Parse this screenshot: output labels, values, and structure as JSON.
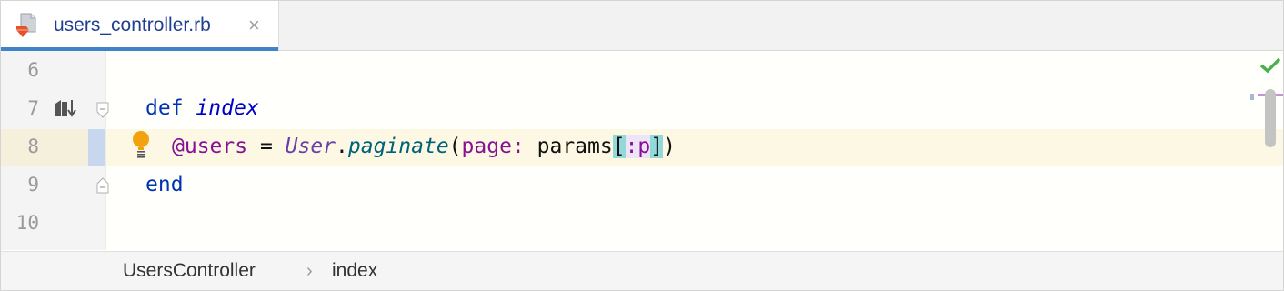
{
  "tab": {
    "filename": "users_controller.rb",
    "close_glyph": "×",
    "file_icon": "ruby-file-icon"
  },
  "editor": {
    "lines": [
      {
        "number": "6"
      },
      {
        "number": "7",
        "tokens": [
          "def",
          "index"
        ]
      },
      {
        "number": "8",
        "tokens": [
          "@users",
          " = ",
          "User",
          ".",
          "paginate",
          "(",
          "page:",
          " params",
          "[",
          ":p",
          "]",
          ")"
        ]
      },
      {
        "number": "9",
        "tokens": [
          "end"
        ]
      },
      {
        "number": "10"
      }
    ],
    "status": "check-icon",
    "colors": {
      "keyword": "#0033b3",
      "ivar": "#871094",
      "method": "#00627a",
      "caret_line": "#fcf8e3",
      "tab_accent": "#4083c9"
    }
  },
  "breadcrumb": {
    "items": [
      "UsersController",
      "index"
    ],
    "separator": "›"
  }
}
